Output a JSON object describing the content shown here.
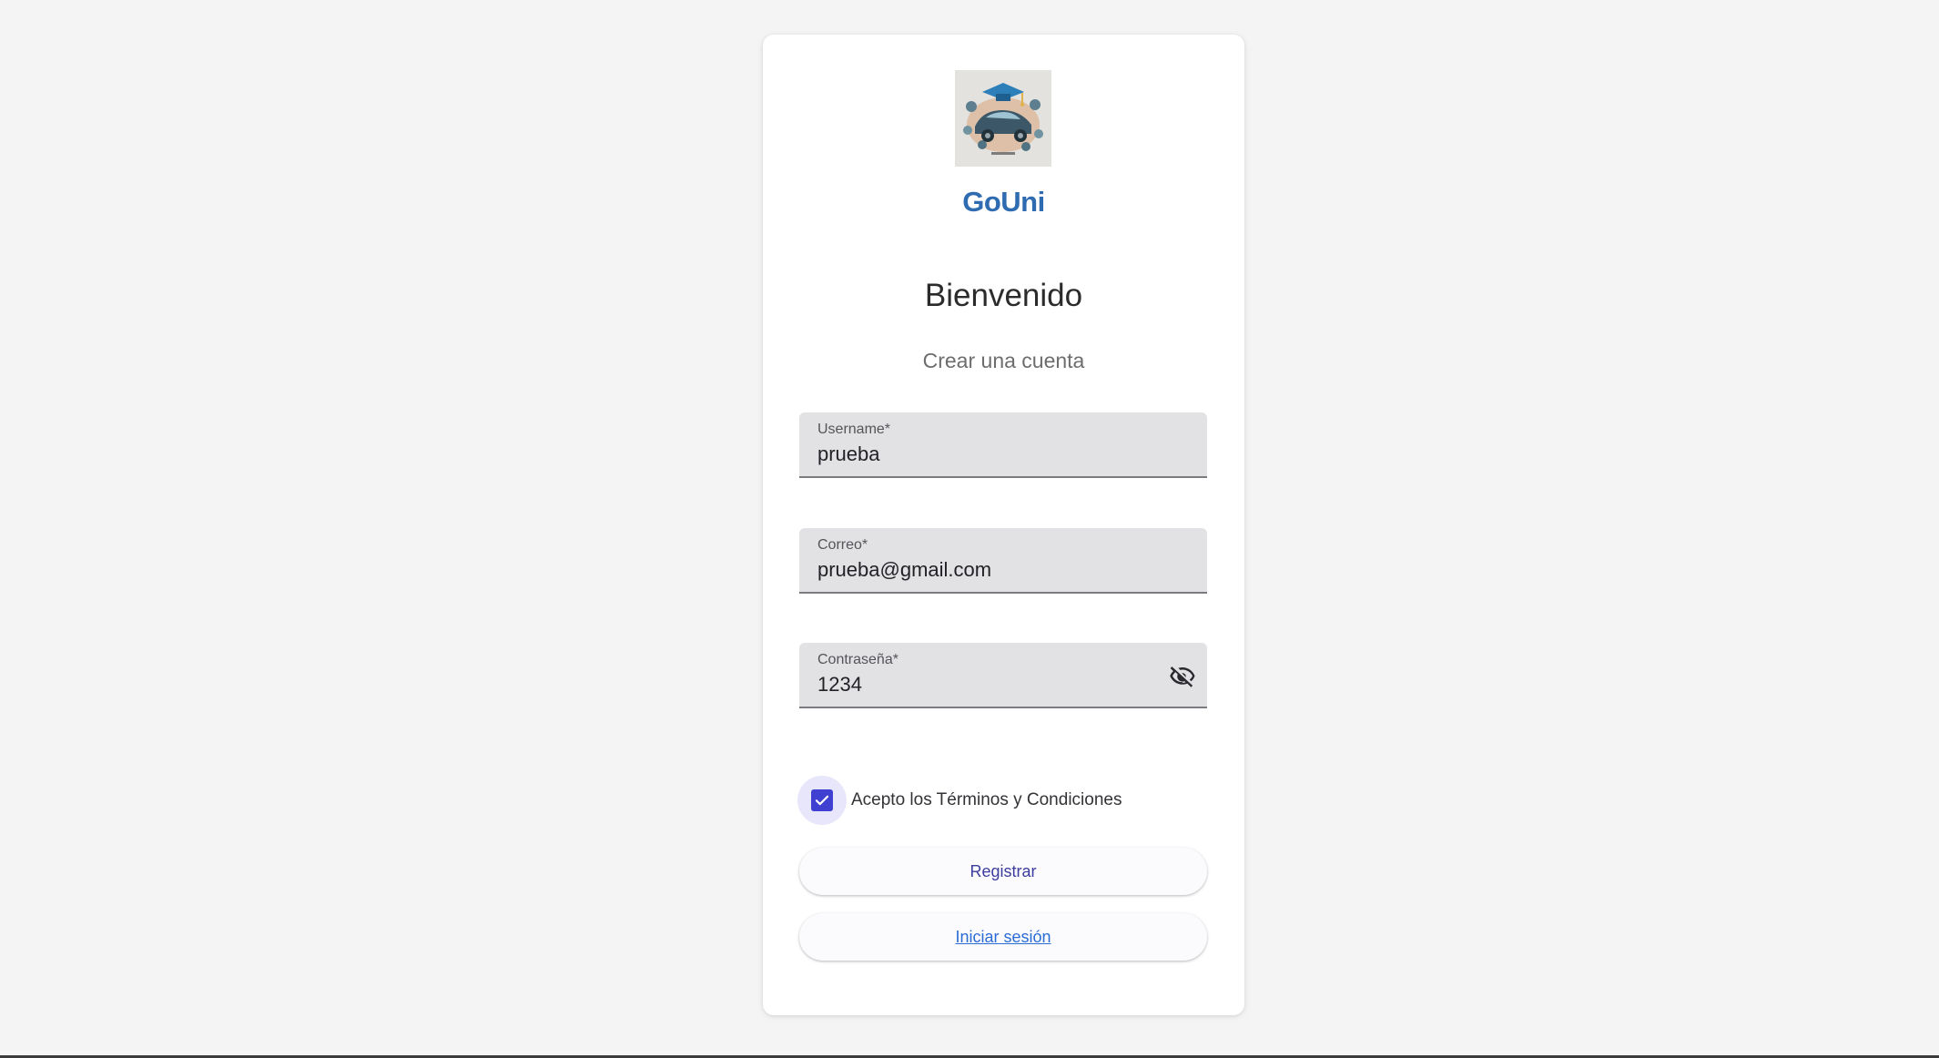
{
  "brand": {
    "name": "GoUni",
    "color": "#2f6bb1",
    "logo_icon": "graduation-cap-car-logo-icon"
  },
  "header": {
    "title": "Bienvenido",
    "subtitle": "Crear una cuenta"
  },
  "form": {
    "username": {
      "label": "Username*",
      "value": "prueba"
    },
    "email": {
      "label": "Correo*",
      "value": "prueba@gmail.com"
    },
    "password": {
      "label": "Contraseña*",
      "value": "1234",
      "toggle_icon": "eye-off-icon"
    },
    "terms": {
      "label": "Acepto los Términos y Condiciones",
      "checked": true
    },
    "register_label": "Registrar",
    "login_label": "Iniciar sesión"
  },
  "colors": {
    "accent": "#3f3fd1",
    "link": "#2b6cd4",
    "field_bg": "#e2e2e5",
    "page_bg": "#f4f4f5"
  }
}
